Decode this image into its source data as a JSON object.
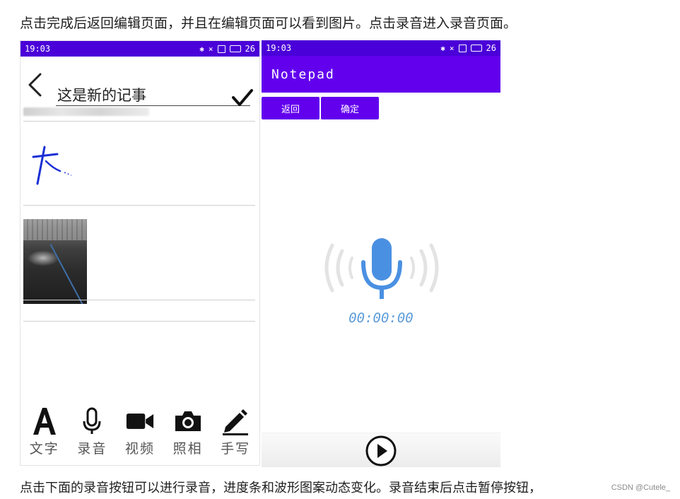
{
  "captions": {
    "top": "点击完成后返回编辑页面，并且在编辑页面可以看到图片。点击录音进入录音页面。",
    "bottom": "点击下面的录音按钮可以进行录音，进度条和波形图案动态变化。录音结束后点击暂停按钮，",
    "watermark": "CSDN @Cutele_"
  },
  "left_screen": {
    "status_time": "19:03",
    "status_battery": "26",
    "title_value": "这是新的记事",
    "toolbar": [
      {
        "label": "文字",
        "icon": "text-icon"
      },
      {
        "label": "录音",
        "icon": "microphone-icon"
      },
      {
        "label": "视频",
        "icon": "video-camera-icon"
      },
      {
        "label": "照相",
        "icon": "camera-icon"
      },
      {
        "label": "手写",
        "icon": "pen-icon"
      }
    ]
  },
  "right_screen": {
    "status_time": "19:03",
    "status_battery": "26",
    "app_title": "Notepad",
    "back_button": "返回",
    "confirm_button": "确定",
    "timer": "00:00:00"
  },
  "colors": {
    "status_bar": "#4a00d8",
    "app_bar": "#6200ee",
    "mic_blue": "#4a90e2",
    "timer_text": "#5b9bd8"
  }
}
